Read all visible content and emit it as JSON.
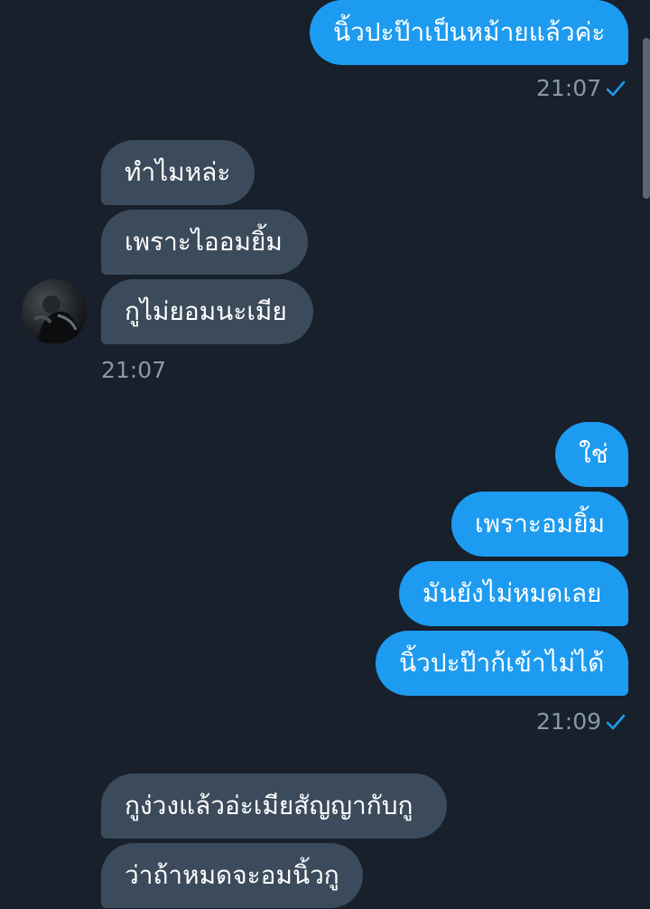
{
  "messages": {
    "m1": "นิ้วปะป๊าเป็นหม้ายแล้วค่ะ",
    "m2": "ทำไมหล่ะ",
    "m3": "เพราะไออมยิ้ม",
    "m4": "กูไม่ยอมนะเมีย",
    "m5": "ใช่",
    "m6": "เพราะอมยิ้ม",
    "m7": "มันยังไม่หมดเลย",
    "m8": "นิ้วปะป๊าก้เข้าไม่ได้",
    "m9": "กูง่วงแล้วอ่ะเมียสัญญากับกู",
    "m10": "ว่าถ้าหมดจะอมนิ้วกู"
  },
  "timestamps": {
    "t1": "21:07",
    "t2": "21:07",
    "t3": "21:09"
  },
  "icons": {
    "read_receipt": "checkmark-icon",
    "avatar": "user-avatar"
  },
  "colors": {
    "background": "#17202b",
    "outgoing_bubble": "#1d9bf0",
    "incoming_bubble": "#3c4b5b",
    "timestamp_text": "#8899a6",
    "read_check": "#1d9bf0"
  }
}
